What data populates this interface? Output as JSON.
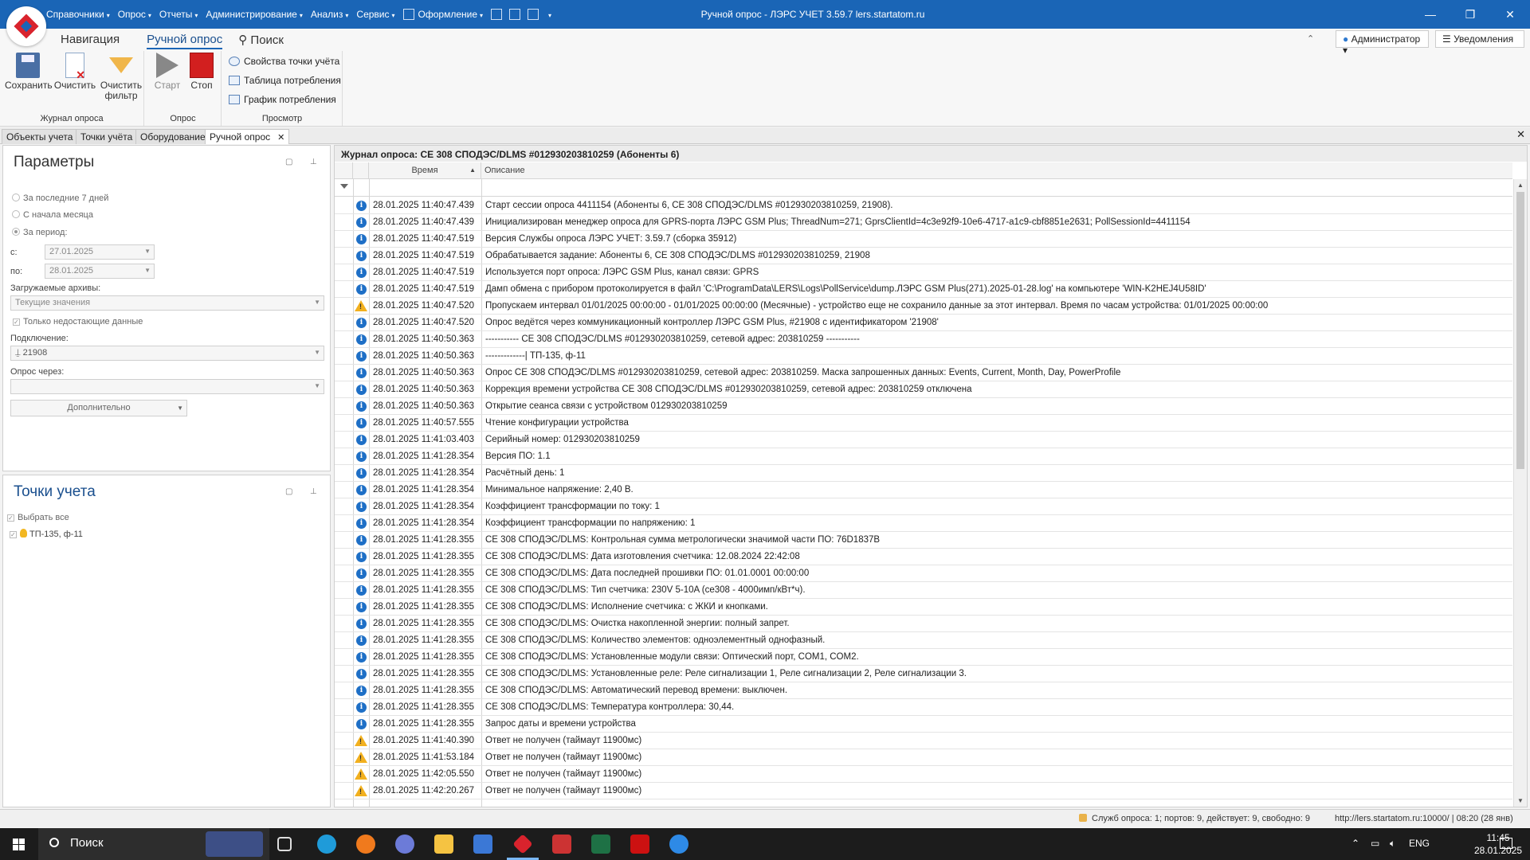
{
  "window": {
    "title": "Ручной опрос - ЛЭРС УЧЕТ 3.59.7 lers.startatom.ru",
    "minimize": "—",
    "restore": "❐",
    "close": "✕"
  },
  "menu": {
    "items": [
      "Справочники",
      "Опрос",
      "Отчеты",
      "Администрирование",
      "Анализ",
      "Сервис"
    ],
    "style_item": "Оформление",
    "caret": "▾"
  },
  "ribbon": {
    "tabs": [
      "Навигация",
      "Ручной опрос",
      "Поиск"
    ],
    "collapse": "⌃",
    "user": "Администратор ▾",
    "notifications": "Уведомления",
    "group_journal": {
      "label": "Журнал опроса",
      "save": "Сохранить",
      "clear": "Очистить",
      "clear_filter_1": "Очистить",
      "clear_filter_2": "фильтр"
    },
    "group_poll": {
      "label": "Опрос",
      "start": "Старт",
      "stop": "Стоп"
    },
    "group_view": {
      "label": "Просмотр",
      "point_props": "Свойства точки учёта",
      "consumption_table": "Таблица потребления",
      "consumption_chart": "График потребления"
    }
  },
  "doc_tabs": [
    "Объекты учета",
    "Точки учёта",
    "Оборудование",
    "Ручной опрос"
  ],
  "doc_tab_close": "✕",
  "params": {
    "title": "Параметры",
    "panel_btn_1": "▢",
    "panel_btn_2": "⊥",
    "radio_7days": "За последние 7 дней",
    "radio_month": "С начала месяца",
    "radio_period": "За период:",
    "from_label": "с:",
    "from_value": "27.01.2025",
    "to_label": "по:",
    "to_value": "28.01.2025",
    "archives_label": "Загружаемые архивы:",
    "archives_value": "Текущие значения",
    "missing_only": "Только недостающие данные",
    "connection_label": "Подключение:",
    "connection_value": "21908",
    "via_label": "Опрос через:",
    "via_value": "",
    "more_button": "Дополнительно"
  },
  "points": {
    "title": "Точки учета",
    "panel_btn_1": "▢",
    "panel_btn_2": "⊥",
    "select_all": "Выбрать все",
    "items": [
      "ТП-135, ф-11"
    ]
  },
  "journal": {
    "title": "Журнал опроса: СЕ 308 СПОДЭС/DLMS #012930203810259 (Абоненты 6)",
    "col_time": "Время",
    "col_time_sort": "▲",
    "col_desc": "Описание",
    "rows": [
      {
        "type": "info",
        "time": "28.01.2025 11:40:47.439",
        "desc": "Старт сессии опроса 4411154 (Абоненты 6, СЕ 308 СПОДЭС/DLMS #012930203810259, 21908)."
      },
      {
        "type": "info",
        "time": "28.01.2025 11:40:47.439",
        "desc": "Инициализирован менеджер опроса для GPRS-порта ЛЭРС GSM Plus; ThreadNum=271; GprsClientId=4c3e92f9-10e6-4717-a1c9-cbf8851e2631; PollSessionId=4411154"
      },
      {
        "type": "info",
        "time": "28.01.2025 11:40:47.519",
        "desc": "Версия Службы опроса ЛЭРС УЧЕТ: 3.59.7 (сборка 35912)"
      },
      {
        "type": "info",
        "time": "28.01.2025 11:40:47.519",
        "desc": "Обрабатывается задание: Абоненты 6, СЕ 308 СПОДЭС/DLMS #012930203810259, 21908"
      },
      {
        "type": "info",
        "time": "28.01.2025 11:40:47.519",
        "desc": "Используется порт опроса: ЛЭРС GSM Plus, канал связи: GPRS"
      },
      {
        "type": "info",
        "time": "28.01.2025 11:40:47.519",
        "desc": "Дамп обмена с прибором протоколируется в файл 'C:\\ProgramData\\LERS\\Logs\\PollService\\dump.ЛЭРС GSM Plus(271).2025-01-28.log' на компьютере 'WIN-K2HEJ4U58ID'"
      },
      {
        "type": "warn",
        "time": "28.01.2025 11:40:47.520",
        "desc": "Пропускаем интервал 01/01/2025 00:00:00 - 01/01/2025 00:00:00 (Месячные) - устройство еще не сохранило данные за этот интервал. Время по часам устройства: 01/01/2025 00:00:00"
      },
      {
        "type": "info",
        "time": "28.01.2025 11:40:47.520",
        "desc": "Опрос ведётся через коммуникационный контроллер ЛЭРС GSM Plus, #21908 с идентификатором '21908'"
      },
      {
        "type": "info",
        "time": "28.01.2025 11:40:50.363",
        "desc": "----------- СЕ 308 СПОДЭС/DLMS #012930203810259, сетевой адрес: 203810259 -----------"
      },
      {
        "type": "info",
        "time": "28.01.2025 11:40:50.363",
        "desc": "-------------| ТП-135, ф-11"
      },
      {
        "type": "info",
        "time": "28.01.2025 11:40:50.363",
        "desc": "Опрос СЕ 308 СПОДЭС/DLMS #012930203810259, сетевой адрес: 203810259. Маска запрошенных данных: Events, Current, Month, Day, PowerProfile"
      },
      {
        "type": "info",
        "time": "28.01.2025 11:40:50.363",
        "desc": "Коррекция времени устройства СЕ 308 СПОДЭС/DLMS #012930203810259, сетевой адрес: 203810259 отключена"
      },
      {
        "type": "info",
        "time": "28.01.2025 11:40:50.363",
        "desc": "Открытие сеанса связи с устройством 012930203810259"
      },
      {
        "type": "info",
        "time": "28.01.2025 11:40:57.555",
        "desc": "Чтение конфигурации устройства"
      },
      {
        "type": "info",
        "time": "28.01.2025 11:41:03.403",
        "desc": "Серийный номер: 012930203810259"
      },
      {
        "type": "info",
        "time": "28.01.2025 11:41:28.354",
        "desc": "Версия ПО: 1.1"
      },
      {
        "type": "info",
        "time": "28.01.2025 11:41:28.354",
        "desc": "Расчётный день: 1"
      },
      {
        "type": "info",
        "time": "28.01.2025 11:41:28.354",
        "desc": "Минимальное напряжение: 2,40 В."
      },
      {
        "type": "info",
        "time": "28.01.2025 11:41:28.354",
        "desc": "Коэффициент трансформации по току: 1"
      },
      {
        "type": "info",
        "time": "28.01.2025 11:41:28.354",
        "desc": "Коэффициент трансформации по напряжению: 1"
      },
      {
        "type": "info",
        "time": "28.01.2025 11:41:28.355",
        "desc": "СЕ 308 СПОДЭС/DLMS: Контрольная сумма метрологически значимой части ПО: 76D1837B"
      },
      {
        "type": "info",
        "time": "28.01.2025 11:41:28.355",
        "desc": "СЕ 308 СПОДЭС/DLMS: Дата изготовления счетчика: 12.08.2024 22:42:08"
      },
      {
        "type": "info",
        "time": "28.01.2025 11:41:28.355",
        "desc": "СЕ 308 СПОДЭС/DLMS: Дата последней прошивки ПО: 01.01.0001 00:00:00"
      },
      {
        "type": "info",
        "time": "28.01.2025 11:41:28.355",
        "desc": "СЕ 308 СПОДЭС/DLMS: Тип счетчика: 230V 5-10A (се308 - 4000имп/кВт*ч)."
      },
      {
        "type": "info",
        "time": "28.01.2025 11:41:28.355",
        "desc": "СЕ 308 СПОДЭС/DLMS: Исполнение счетчика: с ЖКИ и кнопками."
      },
      {
        "type": "info",
        "time": "28.01.2025 11:41:28.355",
        "desc": "СЕ 308 СПОДЭС/DLMS: Очистка накопленной энергии: полный запрет."
      },
      {
        "type": "info",
        "time": "28.01.2025 11:41:28.355",
        "desc": "СЕ 308 СПОДЭС/DLMS: Количество элементов: одноэлементный однофазный."
      },
      {
        "type": "info",
        "time": "28.01.2025 11:41:28.355",
        "desc": "СЕ 308 СПОДЭС/DLMS: Установленные модули связи: Оптический порт, COM1, COM2."
      },
      {
        "type": "info",
        "time": "28.01.2025 11:41:28.355",
        "desc": "СЕ 308 СПОДЭС/DLMS: Установленные реле: Реле сигнализации 1, Реле сигнализации 2, Реле сигнализации 3."
      },
      {
        "type": "info",
        "time": "28.01.2025 11:41:28.355",
        "desc": "СЕ 308 СПОДЭС/DLMS: Автоматический перевод времени: выключен."
      },
      {
        "type": "info",
        "time": "28.01.2025 11:41:28.355",
        "desc": "СЕ 308 СПОДЭС/DLMS: Температура контроллера: 30,44."
      },
      {
        "type": "info",
        "time": "28.01.2025 11:41:28.355",
        "desc": "Запрос даты и времени устройства"
      },
      {
        "type": "warn",
        "time": "28.01.2025 11:41:40.390",
        "desc": "Ответ не получен (таймаут 11900мс)"
      },
      {
        "type": "warn",
        "time": "28.01.2025 11:41:53.184",
        "desc": "Ответ не получен (таймаут 11900мс)"
      },
      {
        "type": "warn",
        "time": "28.01.2025 11:42:05.550",
        "desc": "Ответ не получен (таймаут 11900мс)"
      },
      {
        "type": "warn",
        "time": "28.01.2025 11:42:20.267",
        "desc": "Ответ не получен (таймаут 11900мс)"
      }
    ]
  },
  "status": {
    "services": "Служб опроса: 1; портов: 9, действует: 9, свободно: 9",
    "server": "http://lers.startatom.ru:10000/ | 08:20 (28 янв)"
  },
  "taskbar": {
    "search": "Поиск",
    "lang": "ENG",
    "time": "11:45",
    "date": "28.01.2025"
  },
  "colors": {
    "titlebar": "#1a65b6",
    "accent_red": "#d21f1f",
    "info_blue": "#1e6fc6",
    "warn_yellow": "#f2b01e"
  }
}
